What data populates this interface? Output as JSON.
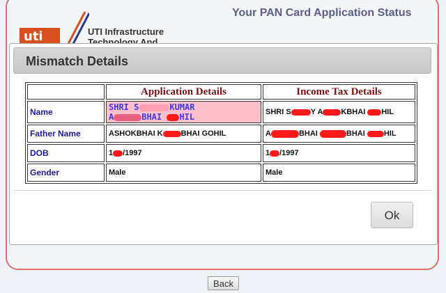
{
  "header": {
    "title": "Your PAN Card Application Status",
    "org_name": "UTI Infrastructure Technology And"
  },
  "modal": {
    "title": "Mismatch Details",
    "columns": {
      "application": "Application Details",
      "income_tax": "Income Tax Details"
    },
    "rows": {
      "name": {
        "label": "Name",
        "app_line1a": "SHRI S",
        "app_line1b": "KUMAR",
        "app_line2a": "A",
        "app_line2b": "BHAI",
        "app_line2c": "HIL",
        "tax_a": "SHRI S",
        "tax_b": "Y A",
        "tax_c": "KBHAI",
        "tax_d": "HIL"
      },
      "father": {
        "label": "Father Name",
        "app_a": "ASHOK",
        "app_b": "BHAI K",
        "app_c": "BHAI GOHIL",
        "tax_a": "A",
        "tax_b": "BHAI",
        "tax_c": "BHAI",
        "tax_d": "HIL"
      },
      "dob": {
        "label": "DOB",
        "app_a": "1",
        "app_b": "/1997",
        "tax_a": "1",
        "tax_b": "/1997"
      },
      "gender": {
        "label": "Gender",
        "app": "Male",
        "tax": "Male"
      }
    },
    "ok_label": "Ok"
  },
  "back_label": "Back",
  "colors": {
    "redaction": "#ff1a1a",
    "highlight": "#ffc0cb",
    "label_blue": "#1a1aa6",
    "header_maroon": "#7a1010"
  }
}
